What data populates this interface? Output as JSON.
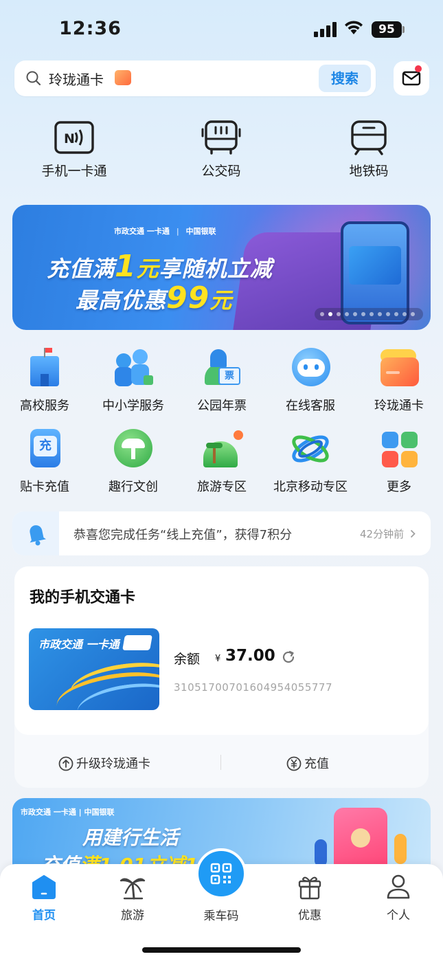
{
  "status_bar": {
    "time": "12:36",
    "battery": "95"
  },
  "search": {
    "query": "玲珑通卡",
    "button": "搜索"
  },
  "quick_actions": [
    {
      "label": "手机一卡通",
      "icon": "nfc-card-icon"
    },
    {
      "label": "公交码",
      "icon": "bus-icon"
    },
    {
      "label": "地铁码",
      "icon": "subway-icon"
    }
  ],
  "banner1": {
    "brand_left": "市政交通 一卡通",
    "brand_right": "中国银联",
    "line1_a": "充值满",
    "line1_num": "1",
    "line1_b": "元",
    "line1_c": "享随机立减",
    "line2_a": "最高优惠",
    "line2_num": "99",
    "line2_b": "元"
  },
  "services": [
    {
      "label": "高校服务",
      "icon": "school-building-icon"
    },
    {
      "label": "中小学服务",
      "icon": "students-icon"
    },
    {
      "label": "公园年票",
      "icon": "park-ticket-icon"
    },
    {
      "label": "在线客服",
      "icon": "customer-service-icon"
    },
    {
      "label": "玲珑通卡",
      "icon": "linglong-card-icon"
    },
    {
      "label": "贴卡充值",
      "icon": "card-recharge-icon"
    },
    {
      "label": "趣行文创",
      "icon": "creative-icon"
    },
    {
      "label": "旅游专区",
      "icon": "travel-icon"
    },
    {
      "label": "北京移动专区",
      "icon": "china-mobile-icon"
    },
    {
      "label": "更多",
      "icon": "more-grid-icon"
    }
  ],
  "notice": {
    "text": "恭喜您完成任务“线上充值”，获得7积分",
    "time": "42分钟前"
  },
  "my_card": {
    "title": "我的手机交通卡",
    "card_name": "市政交通 一卡通",
    "balance_label": "余额",
    "currency": "¥",
    "balance": "37.00",
    "card_number": "31051700701604954055777",
    "upgrade": "升级玲珑通卡",
    "recharge": "充值"
  },
  "banner2": {
    "brand": "市政交通 一卡通 | 中国银联",
    "line1": "用建行生活",
    "line2_a": "充值",
    "line2_b": "满1.01立减1"
  },
  "tabs": [
    {
      "label": "首页",
      "active": true
    },
    {
      "label": "旅游"
    },
    {
      "label": "乘车码"
    },
    {
      "label": "优惠"
    },
    {
      "label": "个人"
    }
  ],
  "colors": {
    "accent": "#1f8ff1",
    "banner_yellow": "#ffe21f"
  }
}
